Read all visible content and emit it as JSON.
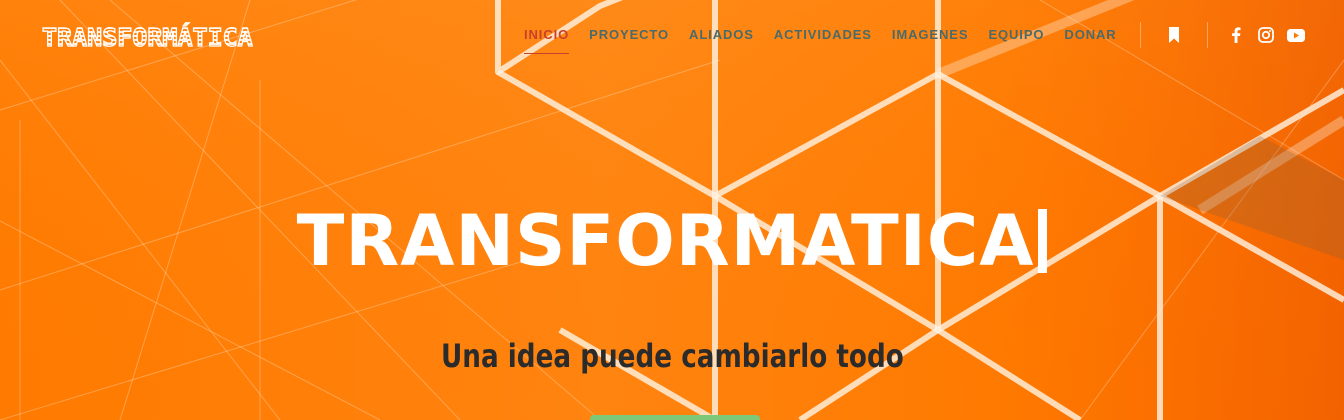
{
  "header": {
    "logo_text": "TRANSFORMÁTICA",
    "nav": [
      {
        "label": "INICIO",
        "active": true
      },
      {
        "label": "PROYECTO",
        "active": false
      },
      {
        "label": "ALIADOS",
        "active": false
      },
      {
        "label": "ACTIVIDADES",
        "active": false
      },
      {
        "label": "IMAGENES",
        "active": false
      },
      {
        "label": "EQUIPO",
        "active": false
      },
      {
        "label": "DONAR",
        "active": false
      }
    ],
    "icons": [
      "bookmark-icon",
      "facebook-icon",
      "instagram-icon",
      "youtube-icon"
    ]
  },
  "hero": {
    "title": "TRANSFORMATICA",
    "subtitle": "Una idea puede cambiarlo todo"
  },
  "colors": {
    "background": "#ff7a00",
    "nav_text": "#4a6b6a",
    "nav_active": "#c9412a",
    "title": "#ffffff",
    "subtitle": "#2b2b2b",
    "cta": "#7ec87a"
  }
}
